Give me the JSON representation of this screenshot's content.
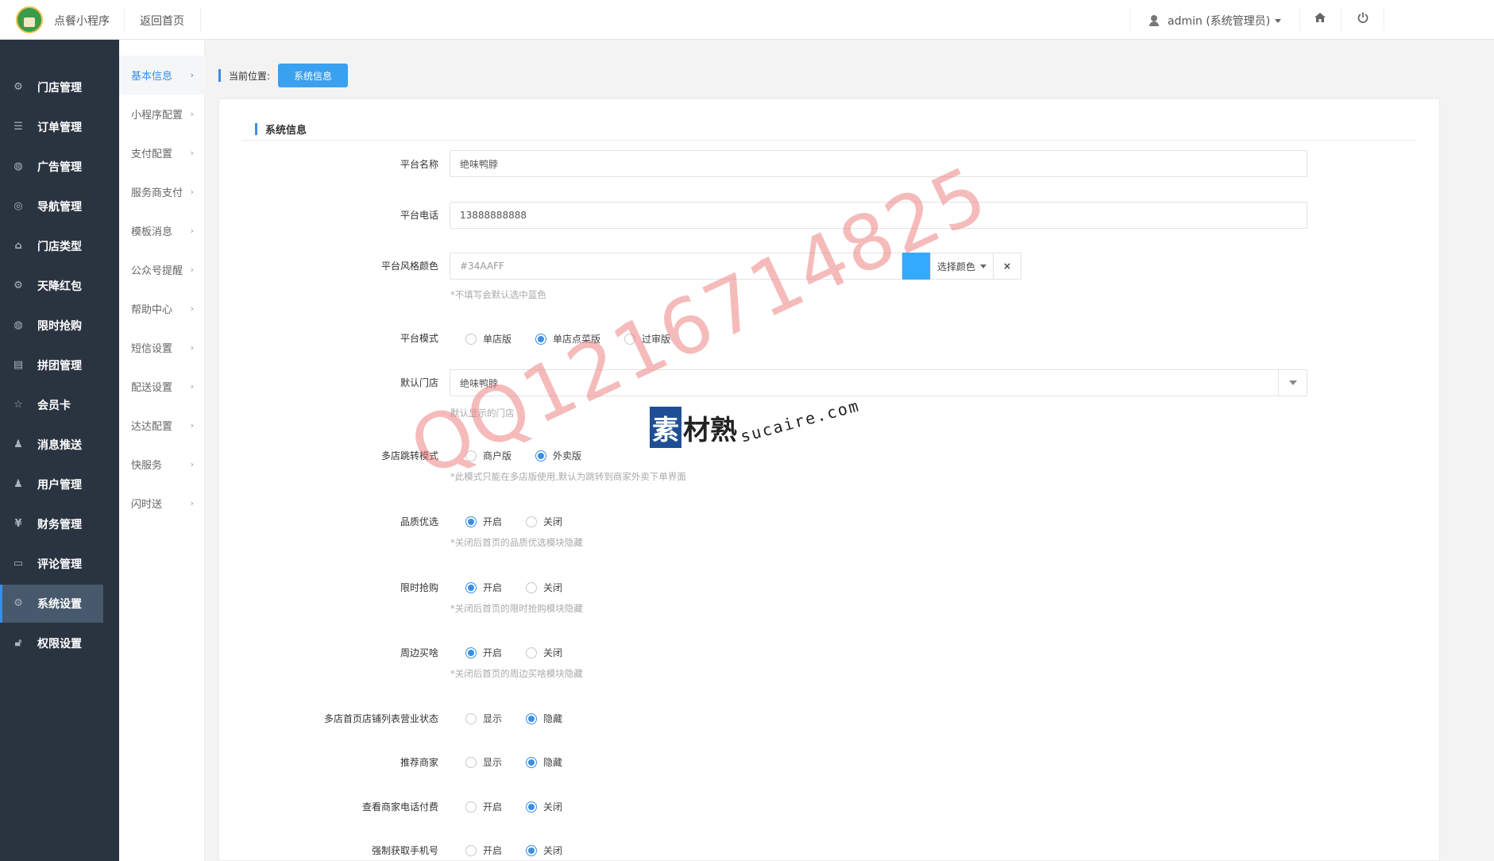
{
  "header": {
    "app_name": "点餐小程序",
    "back_home": "返回首页",
    "user": "admin (系统管理员)",
    "home_icon": "home-icon",
    "power_icon": "power-icon"
  },
  "sidebar": {
    "items": [
      {
        "label": "门店管理",
        "icon": "store-icon"
      },
      {
        "label": "订单管理",
        "icon": "list-icon"
      },
      {
        "label": "广告管理",
        "icon": "ad-icon"
      },
      {
        "label": "导航管理",
        "icon": "compass-icon"
      },
      {
        "label": "门店类型",
        "icon": "bank-icon"
      },
      {
        "label": "天降红包",
        "icon": "gift-icon"
      },
      {
        "label": "限时抢购",
        "icon": "clock-icon"
      },
      {
        "label": "拼团管理",
        "icon": "group-icon"
      },
      {
        "label": "会员卡",
        "icon": "star-icon"
      },
      {
        "label": "消息推送",
        "icon": "users-icon"
      },
      {
        "label": "用户管理",
        "icon": "user-icon"
      },
      {
        "label": "财务管理",
        "icon": "yen-icon"
      },
      {
        "label": "评论管理",
        "icon": "comment-icon"
      },
      {
        "label": "系统设置",
        "icon": "gear-icon"
      },
      {
        "label": "权限设置",
        "icon": "lock-icon"
      }
    ],
    "active_index": 13
  },
  "subnav": {
    "items": [
      "基本信息",
      "小程序配置",
      "支付配置",
      "服务商支付",
      "模板消息",
      "公众号提醒",
      "帮助中心",
      "短信设置",
      "配送设置",
      "达达配置",
      "快服务",
      "闪时送"
    ],
    "active_index": 0
  },
  "breadcrumb": {
    "label": "当前位置:",
    "current": "系统信息"
  },
  "panel": {
    "title": "系统信息"
  },
  "form": {
    "platform_name": {
      "label": "平台名称",
      "value": "绝味鸭脖"
    },
    "platform_phone": {
      "label": "平台电话",
      "value": "13888888888"
    },
    "platform_color": {
      "label": "平台风格颜色",
      "placeholder": "#34AAFF",
      "swatch": "#34aaff",
      "button": "选择颜色",
      "clear": "×",
      "hint": "*不填写会默认选中蓝色"
    },
    "platform_mode": {
      "label": "平台模式",
      "options": [
        "单店版",
        "单店点菜版",
        "过审版"
      ],
      "selected": 1
    },
    "default_store": {
      "label": "默认门店",
      "value": "绝味鸭脖",
      "hint": "默认显示的门店"
    },
    "multi_store_jump": {
      "label": "多店跳转模式",
      "options": [
        "商户版",
        "外卖版"
      ],
      "selected": 1,
      "hint": "*此模式只能在多店版使用,默认为跳转到商家外卖下单界面"
    },
    "quality": {
      "label": "品质优选",
      "options": [
        "开启",
        "关闭"
      ],
      "selected": 0,
      "hint": "*关闭后首页的品质优选模块隐藏"
    },
    "flash_sale": {
      "label": "限时抢购",
      "options": [
        "开启",
        "关闭"
      ],
      "selected": 0,
      "hint": "*关闭后首页的限时抢购模块隐藏"
    },
    "nearby": {
      "label": "周边买啥",
      "options": [
        "开启",
        "关闭"
      ],
      "selected": 0,
      "hint": "*关闭后首页的周边买啥模块隐藏"
    },
    "store_status": {
      "label": "多店首页店铺列表营业状态",
      "options": [
        "显示",
        "隐藏"
      ],
      "selected": 1
    },
    "recommend": {
      "label": "推荐商家",
      "options": [
        "显示",
        "隐藏"
      ],
      "selected": 1
    },
    "phone_pay": {
      "label": "查看商家电话付费",
      "options": [
        "开启",
        "关闭"
      ],
      "selected": 1
    },
    "force_phone": {
      "label": "强制获取手机号",
      "options": [
        "开启",
        "关闭"
      ],
      "selected": 1
    }
  },
  "watermark": {
    "text": "QQ1216714825",
    "brand": "素材熟",
    "url": "sucaire.com"
  }
}
